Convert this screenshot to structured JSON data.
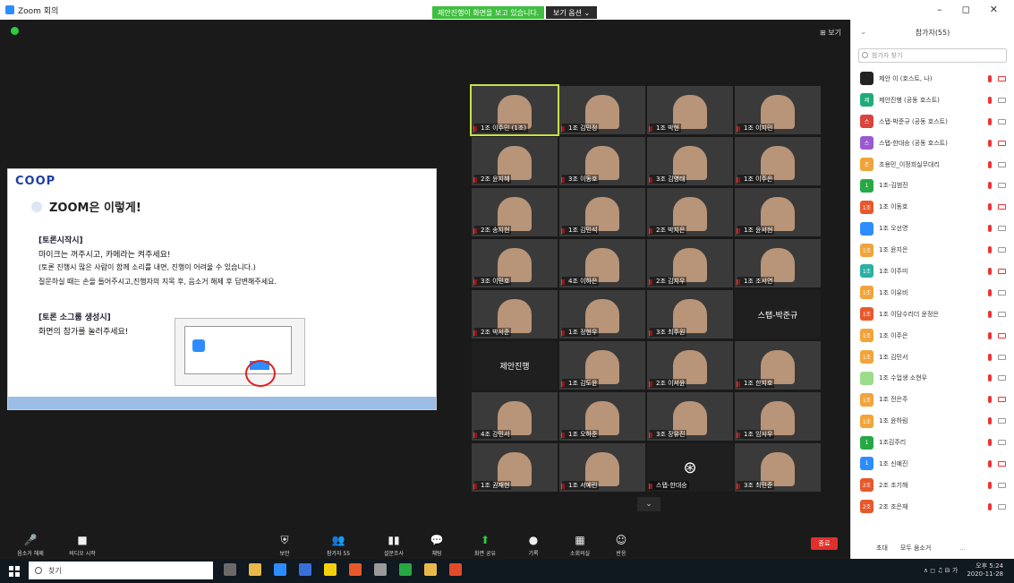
{
  "titlebar": {
    "title": "Zoom 회의",
    "share_banner": "제안진행이 화면을 보고 있습니다.",
    "share_menu": "보기 옵션 ⌄",
    "controls": [
      "–",
      "◻",
      "✕"
    ]
  },
  "stage": {
    "view_label": "⊞ 보기"
  },
  "slide": {
    "logo": "COOP",
    "heading": "ZOOM은 이렇게!",
    "section1": "[토론시작시]",
    "line1": "마이크는 꺼주시고, 카메라는 켜주세요!",
    "line2": "(토론 진행시 많은 사람이 함께 소리를 내면, 진행이 어려울 수 있습니다.)",
    "line3": "질문하실 때는 손을 들어주시고,진행자의 지목 후, 음소거 해제 후 답변해주세요.",
    "section2": "[토론 소그룹 생성시]",
    "line4": "화면의 참가를 눌러주세요!"
  },
  "grid": {
    "tiles": [
      {
        "name": "1조 이주민 (1조)",
        "active": true
      },
      {
        "name": "1조 김민정"
      },
      {
        "name": "1조 박현"
      },
      {
        "name": "1조 이지민"
      },
      {
        "name": "2조 윤지혜"
      },
      {
        "name": "3조 이동호"
      },
      {
        "name": "3조 김영태"
      },
      {
        "name": "1조 이주은"
      },
      {
        "name": "2조 송지현"
      },
      {
        "name": "1조 김민석"
      },
      {
        "name": "2조 박지은"
      },
      {
        "name": "1조 윤서현"
      },
      {
        "name": "3조 이민호"
      },
      {
        "name": "4조 이하은"
      },
      {
        "name": "2조 김지우"
      },
      {
        "name": "1조 조서연"
      },
      {
        "name": "2조 박서준"
      },
      {
        "name": "1조 정현우"
      },
      {
        "name": "3조 최주원"
      },
      {
        "name": "",
        "center": "스탭-박준규",
        "dark": true
      },
      {
        "name": "",
        "center": "제안진행",
        "dark": true
      },
      {
        "name": "1조 김도윤"
      },
      {
        "name": "2조 이서윤"
      },
      {
        "name": "1조 한지호"
      },
      {
        "name": "4조 강민서"
      },
      {
        "name": "1조 오하준"
      },
      {
        "name": "3조 장유진"
      },
      {
        "name": "1조 임시우"
      },
      {
        "name": "1조 권재현"
      },
      {
        "name": "1조 서예린"
      },
      {
        "name": "스탭-한대승",
        "center": "",
        "dark": true,
        "logo": "⊛"
      },
      {
        "name": "3조 최민준"
      }
    ],
    "more": "⌄"
  },
  "toolbar": {
    "items": [
      {
        "icon": "🎤",
        "label": "음소거 해제"
      },
      {
        "icon": "■",
        "label": "비디오 시작"
      },
      {
        "icon": "⛨",
        "label": "보안"
      },
      {
        "icon": "👥",
        "label": "참가자 55"
      },
      {
        "icon": "▮▮",
        "label": "설문조사"
      },
      {
        "icon": "💬",
        "label": "채팅"
      },
      {
        "icon": "⬆",
        "label": "화면 공유"
      },
      {
        "icon": "●",
        "label": "기록"
      },
      {
        "icon": "▦",
        "label": "소회의실"
      },
      {
        "icon": "☺",
        "label": "반응"
      }
    ],
    "end_label": "종료"
  },
  "panel": {
    "title": "참가자(55)",
    "collapse": "⌄",
    "search_placeholder": "참가자 찾기",
    "participants": [
      {
        "name": "제안 이 (호스트, 나)",
        "color": "#222222",
        "initial": ""
      },
      {
        "name": "제안진행 (공동 호스트)",
        "color": "#1faa7a",
        "initial": "제"
      },
      {
        "name": "스탭-박준규 (공동 호스트)",
        "color": "#d9443c",
        "initial": "스"
      },
      {
        "name": "스탭-한대승 (공동 호스트)",
        "color": "#9b59d0",
        "initial": "스"
      },
      {
        "name": "조용민_이정희실무대리",
        "color": "#f2a33a",
        "initial": "조"
      },
      {
        "name": "1조-김범진",
        "color": "#27a844",
        "initial": "1"
      },
      {
        "name": "1조 이동호",
        "color": "#e8582a",
        "initial": "1조"
      },
      {
        "name": "1조 오선영",
        "color": "#2d8cff",
        "initial": ""
      },
      {
        "name": "1조 윤지은",
        "color": "#f2a33a",
        "initial": "1조"
      },
      {
        "name": "1조 이주미",
        "color": "#2ab0a0",
        "initial": "1조"
      },
      {
        "name": "1조 이유비",
        "color": "#f2a33a",
        "initial": "1조"
      },
      {
        "name": "1조 이담수리더 윤정은",
        "color": "#e8582a",
        "initial": "1조"
      },
      {
        "name": "1조 이주은",
        "color": "#f2a33a",
        "initial": "1조"
      },
      {
        "name": "1조 김민서",
        "color": "#f2a33a",
        "initial": "1조"
      },
      {
        "name": "1조 수업생 소현우",
        "color": "#9ddc8a",
        "initial": ""
      },
      {
        "name": "1조 전은주",
        "color": "#f2a33a",
        "initial": "1조"
      },
      {
        "name": "1조 윤하림",
        "color": "#f2a33a",
        "initial": "1조"
      },
      {
        "name": "1조김주리",
        "color": "#27a844",
        "initial": "1"
      },
      {
        "name": "1조 신예진",
        "color": "#2d8cff",
        "initial": "1"
      },
      {
        "name": "2조 조기해",
        "color": "#e8582a",
        "initial": "2조"
      },
      {
        "name": "2조 조은재",
        "color": "#e8582a",
        "initial": "2조"
      }
    ],
    "invite": "초대",
    "mute_all": "모두 음소거",
    "more": "..."
  },
  "taskbar": {
    "search_placeholder": "찾기",
    "tray": "∧ ◻ ♫ ⊟ 가",
    "time": "오후 5:24",
    "date": "2020-11-28"
  }
}
